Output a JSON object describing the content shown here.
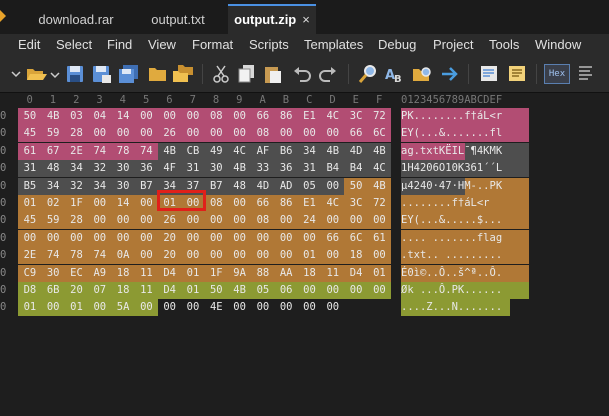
{
  "tabs": [
    {
      "label": "download.rar",
      "active": false
    },
    {
      "label": "output.txt",
      "active": false
    },
    {
      "label": "output.zip",
      "active": true,
      "close": "×"
    }
  ],
  "menu": [
    "Edit",
    "Select",
    "Find",
    "View",
    "Format",
    "Scripts",
    "Templates",
    "Debug",
    "Project",
    "Tools",
    "Window"
  ],
  "toolbar_icons": [
    "dropdown-arrow",
    "folder-open",
    "save",
    "save-as",
    "save-all",
    "folder",
    "folders",
    "cut",
    "copy",
    "paste",
    "undo",
    "redo",
    "find",
    "find-replace",
    "find-in-files",
    "goto",
    "script",
    "template",
    "hex-toggle",
    "text-toggle"
  ],
  "hex_toggle_label": "Hex",
  "column_headers": [
    "0",
    "1",
    "2",
    "3",
    "4",
    "5",
    "6",
    "7",
    "8",
    "9",
    "A",
    "B",
    "C",
    "D",
    "E",
    "F"
  ],
  "ascii_header": "0123456789ABCDEF",
  "row_labels": [
    "0",
    "0",
    "0",
    "0",
    "0",
    "0",
    "0",
    "0",
    "0",
    "0",
    "0",
    "0"
  ],
  "rows": [
    [
      "50",
      "4B",
      "03",
      "04",
      "14",
      "00",
      "00",
      "00",
      "08",
      "00",
      "66",
      "86",
      "E1",
      "4C",
      "3C",
      "72"
    ],
    [
      "45",
      "59",
      "28",
      "00",
      "00",
      "00",
      "26",
      "00",
      "00",
      "00",
      "08",
      "00",
      "00",
      "00",
      "66",
      "6C"
    ],
    [
      "61",
      "67",
      "2E",
      "74",
      "78",
      "74",
      "4B",
      "CB",
      "49",
      "4C",
      "AF",
      "B6",
      "34",
      "4B",
      "4D",
      "4B"
    ],
    [
      "31",
      "48",
      "34",
      "32",
      "30",
      "36",
      "4F",
      "31",
      "30",
      "4B",
      "33",
      "36",
      "31",
      "B4",
      "B4",
      "4C"
    ],
    [
      "B5",
      "34",
      "32",
      "34",
      "30",
      "B7",
      "34",
      "37",
      "B7",
      "48",
      "4D",
      "AD",
      "05",
      "00",
      "50",
      "4B"
    ],
    [
      "01",
      "02",
      "1F",
      "00",
      "14",
      "00",
      "01",
      "00",
      "08",
      "00",
      "66",
      "86",
      "E1",
      "4C",
      "3C",
      "72"
    ],
    [
      "45",
      "59",
      "28",
      "00",
      "00",
      "00",
      "26",
      "00",
      "00",
      "00",
      "08",
      "00",
      "24",
      "00",
      "00",
      "00"
    ],
    [
      "00",
      "00",
      "00",
      "00",
      "00",
      "00",
      "20",
      "00",
      "00",
      "00",
      "00",
      "00",
      "00",
      "66",
      "6C",
      "61",
      "67"
    ],
    [
      "2E",
      "74",
      "78",
      "74",
      "0A",
      "00",
      "20",
      "00",
      "00",
      "00",
      "00",
      "00",
      "01",
      "00",
      "18",
      "00"
    ],
    [
      "C9",
      "30",
      "EC",
      "A9",
      "18",
      "11",
      "D4",
      "01",
      "1F",
      "9A",
      "88",
      "AA",
      "18",
      "11",
      "D4",
      "01"
    ],
    [
      "D8",
      "6B",
      "20",
      "07",
      "18",
      "11",
      "D4",
      "01",
      "50",
      "4B",
      "05",
      "06",
      "00",
      "00",
      "00",
      "00"
    ],
    [
      "01",
      "00",
      "01",
      "00",
      "5A",
      "00",
      "00",
      "00",
      "4E",
      "00",
      "00",
      "00",
      "00",
      "00",
      "",
      ""
    ]
  ],
  "ascii_rows": [
    "PK........f†áL<r",
    "EY(...&.......fl",
    "ag.txtKËIL¯¶4KMK",
    "1H4206O10K361´´L",
    "µ4240·47·HM-..PK",
    "........f†áL<r",
    "EY(...&.....$...",
    ".... .......flag",
    ".txt.. .........",
    "É0ì©..Ô..š^ª..Ô.",
    "Øk ...Ô.PK......",
    "....Z...N......."
  ],
  "colors": {
    "zip_local_header": "#b24d73",
    "zip_data": "#4e4e4e",
    "zip_central_dir": "#b07836",
    "zip_end_record": "#8c9a33",
    "highlight_box": "#e0201a"
  }
}
